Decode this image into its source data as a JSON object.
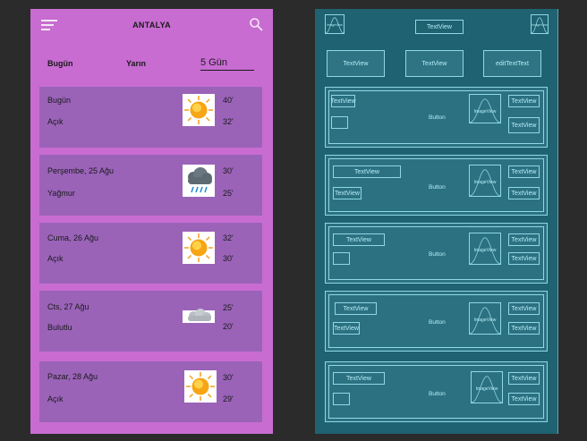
{
  "design": {
    "title": "ANTALYA",
    "tabs": {
      "today": "Bugün",
      "tomorrow": "Yarın"
    },
    "days_input": {
      "value": "5 Gün"
    },
    "cards": [
      {
        "day": "Bugün",
        "condition": "Açık",
        "high": "40'",
        "low": "32'",
        "icon": "sun-icon"
      },
      {
        "day": "Perşembe, 25 Ağu",
        "condition": "Yağmur",
        "high": "30'",
        "low": "25'",
        "icon": "rain-cloud-icon"
      },
      {
        "day": "Cuma, 26 Ağu",
        "condition": "Açık",
        "high": "32'",
        "low": "30'",
        "icon": "sun-icon"
      },
      {
        "day": "Cts, 27 Ağu",
        "condition": "Bulutlu",
        "high": "25'",
        "low": "20'",
        "icon": "cloud-icon"
      },
      {
        "day": "Pazar, 28 Ağu",
        "condition": "Açık",
        "high": "30'",
        "low": "29'",
        "icon": "sun-icon"
      }
    ]
  },
  "blueprint": {
    "header_text": "TextView",
    "image_label": "ImageView",
    "tabs": [
      "TextView",
      "TextView",
      "editTextText"
    ],
    "button_label": "Button",
    "text_label": "TextView"
  },
  "colors": {
    "design_bg": "#c86cd2",
    "card_bg": "#9a63b8",
    "blueprint_bg": "#1f6272",
    "blueprint_line": "#8fd8e6"
  }
}
